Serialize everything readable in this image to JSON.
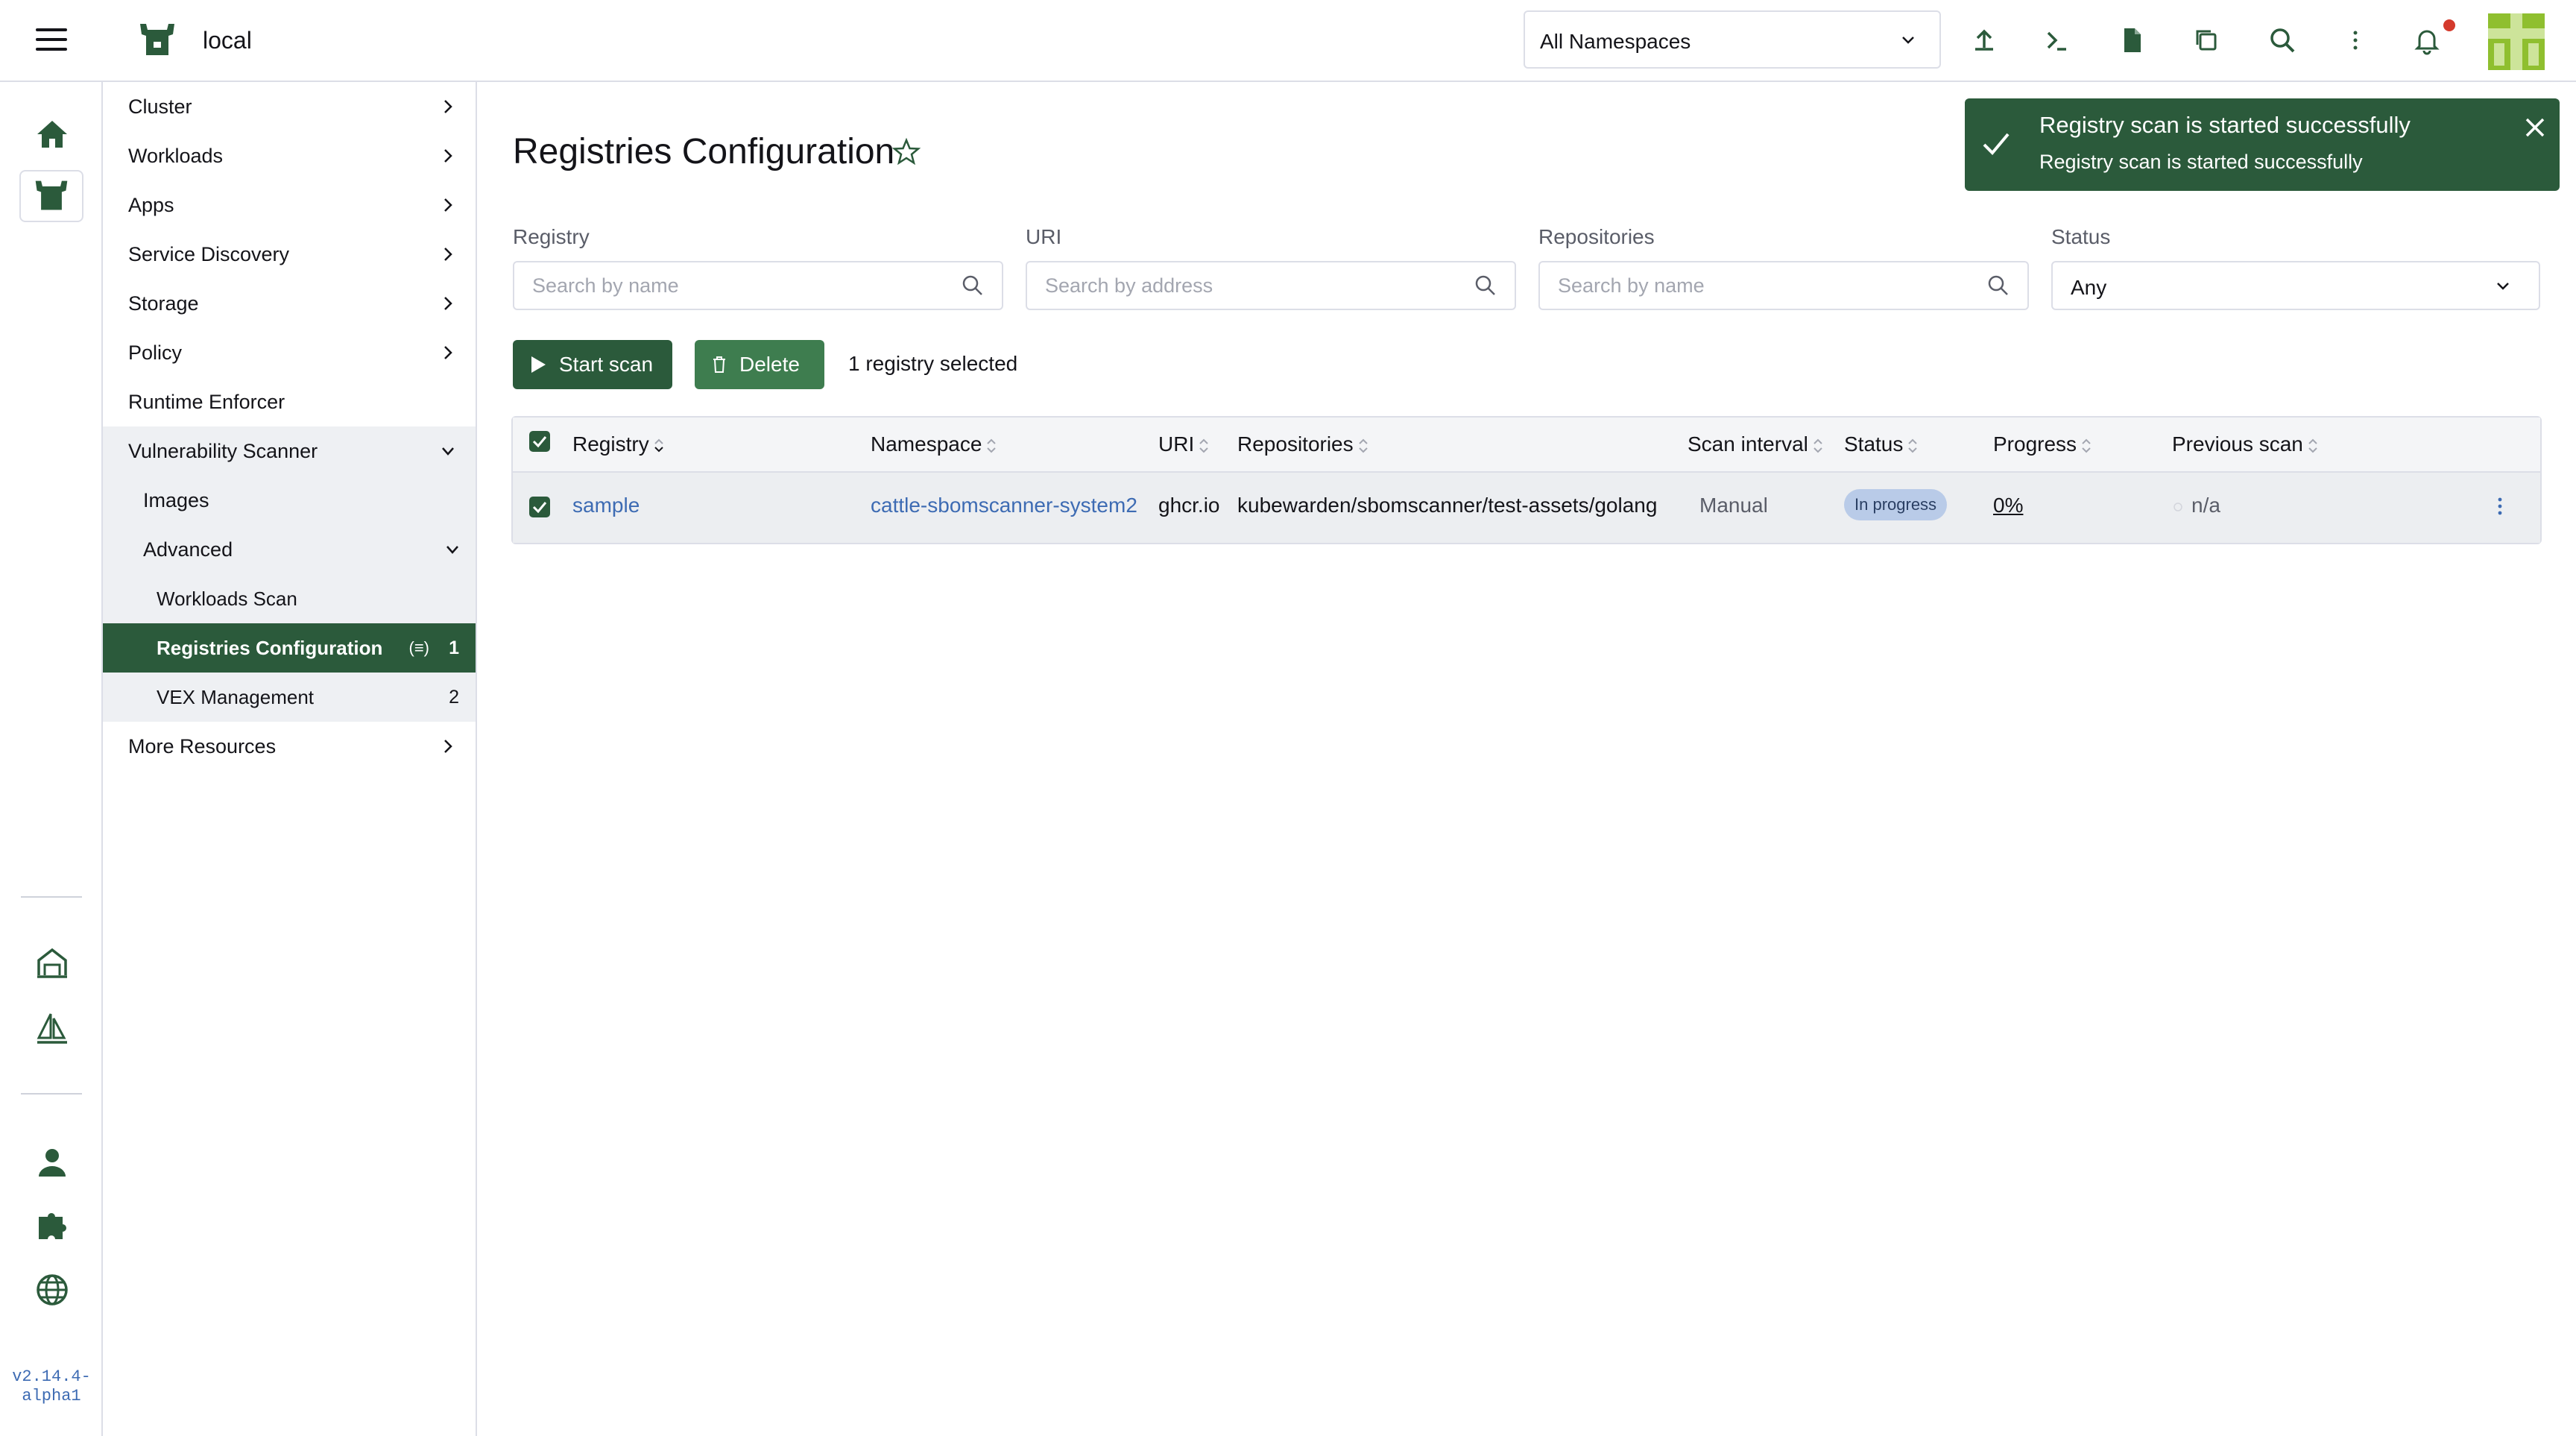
{
  "header": {
    "cluster_name": "local",
    "namespace_select": "All Namespaces",
    "notification_dot_color": "#d43a2c"
  },
  "rail": {
    "version": "v2.14.4-alpha1"
  },
  "sidenav": {
    "items": [
      {
        "label": "Cluster"
      },
      {
        "label": "Workloads"
      },
      {
        "label": "Apps"
      },
      {
        "label": "Service Discovery"
      },
      {
        "label": "Storage"
      },
      {
        "label": "Policy"
      },
      {
        "label": "Runtime Enforcer"
      },
      {
        "label": "Vulnerability Scanner"
      },
      {
        "label": "Images"
      },
      {
        "label": "Advanced"
      },
      {
        "label": "Workloads Scan"
      },
      {
        "label": "Registries Configuration",
        "count": "1"
      },
      {
        "label": "VEX Management",
        "count": "2"
      },
      {
        "label": "More Resources"
      }
    ]
  },
  "page": {
    "title": "Registries Configuration",
    "filters": {
      "registry": {
        "label": "Registry",
        "placeholder": "Search by name"
      },
      "uri": {
        "label": "URI",
        "placeholder": "Search by address"
      },
      "repositories": {
        "label": "Repositories",
        "placeholder": "Search by name"
      },
      "status": {
        "label": "Status",
        "value": "Any"
      }
    },
    "actions": {
      "start_scan": "Start scan",
      "delete": "Delete",
      "selection_text": "1 registry selected"
    },
    "table": {
      "columns": [
        "Registry",
        "Namespace",
        "URI",
        "Repositories",
        "Scan interval",
        "Status",
        "Progress",
        "Previous scan"
      ],
      "rows": [
        {
          "registry": "sample",
          "namespace": "cattle-sbomscanner-system2",
          "uri": "ghcr.io",
          "repositories": "kubewarden/sbomscanner/test-assets/golang",
          "scan_interval": "Manual",
          "status": "In progress",
          "progress": "0%",
          "previous_scan": "n/a",
          "selected": true
        }
      ]
    }
  },
  "toast": {
    "title": "Registry scan is started successfully",
    "message": "Registry scan is started successfully"
  },
  "colors": {
    "brand_green": "#2b5a3b",
    "link_blue": "#3d6bb3",
    "badge_blue": "#b9cbe8"
  }
}
